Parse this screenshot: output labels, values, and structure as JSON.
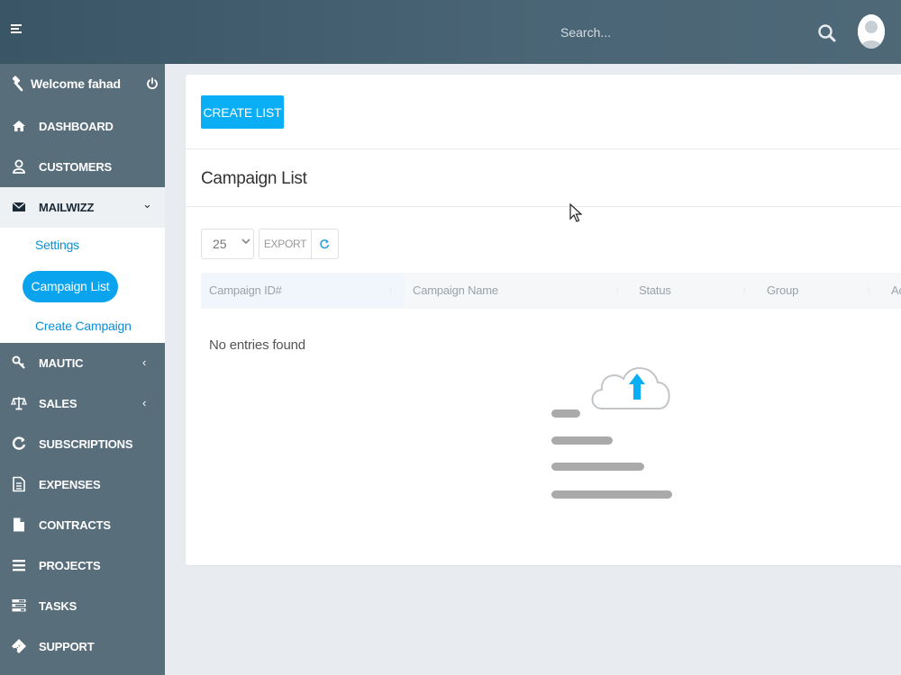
{
  "header": {
    "search_placeholder": "Search..."
  },
  "sidebar": {
    "welcome": "Welcome fahad",
    "items": [
      {
        "label": "DASHBOARD",
        "icon": "home-icon"
      },
      {
        "label": "CUSTOMERS",
        "icon": "user-icon"
      },
      {
        "label": "MAILWIZZ",
        "icon": "envelope-icon",
        "caret": "⌄"
      },
      {
        "label": "MAUTIC",
        "icon": "key-icon",
        "caret": "‹"
      },
      {
        "label": "SALES",
        "icon": "balance-scale-icon",
        "caret": "‹"
      },
      {
        "label": "SUBSCRIPTIONS",
        "icon": "refresh-icon"
      },
      {
        "label": "EXPENSES",
        "icon": "file-text-icon"
      },
      {
        "label": "CONTRACTS",
        "icon": "file-icon"
      },
      {
        "label": "PROJECTS",
        "icon": "bars-icon"
      },
      {
        "label": "TASKS",
        "icon": "tasks-icon"
      },
      {
        "label": "SUPPORT",
        "icon": "ticket-icon"
      }
    ],
    "submenu": [
      "Settings",
      "Campaign List",
      "Create Campaign"
    ]
  },
  "main": {
    "create_button": "CREATE LIST",
    "title": "Campaign List",
    "page_size": "25",
    "export_label": "EXPORT",
    "columns": [
      "Campaign ID#",
      "Campaign Name",
      "Status",
      "Group",
      "Ac"
    ],
    "empty_text": "No entries found"
  },
  "colors": {
    "header": "#3a5566",
    "sidebar": "#596e7b",
    "accent": "#09aef5",
    "link": "#0b8fd6"
  }
}
